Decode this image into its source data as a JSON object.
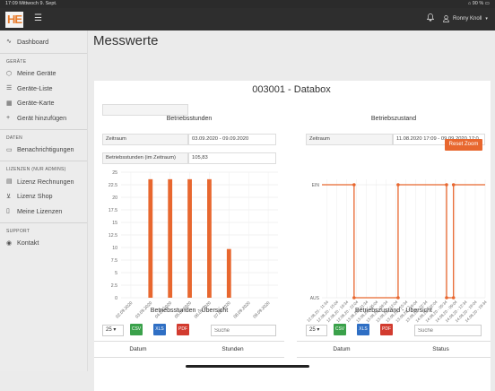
{
  "status_bar": {
    "time_date": "17:09  Mittwoch 9. Sept.",
    "battery": "90 %"
  },
  "app": {
    "logo_text": "HE",
    "user_name": "Ronny Knoll"
  },
  "sidebar": {
    "dashboard": "Dashboard",
    "sections": [
      {
        "title": "GERÄTE",
        "items": [
          {
            "label": "Meine Geräte",
            "icon": "cube-icon"
          },
          {
            "label": "Geräte-Liste",
            "icon": "list-icon"
          },
          {
            "label": "Geräte-Karte",
            "icon": "map-icon"
          },
          {
            "label": "Gerät hinzufügen",
            "icon": "plus-icon"
          }
        ]
      },
      {
        "title": "DATEN",
        "items": [
          {
            "label": "Benachrichtigungen",
            "icon": "chat-icon"
          }
        ]
      },
      {
        "title": "LIZENZEN (NUR ADMINS)",
        "items": [
          {
            "label": "Lizenz Rechnungen",
            "icon": "document-icon"
          },
          {
            "label": "Lizenz Shop",
            "icon": "cart-icon"
          },
          {
            "label": "Meine Lizenzen",
            "icon": "file-icon"
          }
        ]
      },
      {
        "title": "SUPPORT",
        "items": [
          {
            "label": "Kontakt",
            "icon": "eye-icon"
          }
        ]
      }
    ]
  },
  "page": {
    "title": "Messwerte",
    "device_title": "003001 - Databox"
  },
  "left_panel": {
    "title": "Betriebsstunden",
    "zeitraum_label": "Zeitraum",
    "zeitraum_value": "03.09.2020 - 09.09.2020",
    "hours_label": "Betriebsstunden (im Zeitraum)",
    "hours_value": "105,83",
    "table_title": "Betriebsstunden - Übersicht",
    "page_size": "25",
    "search_placeholder": "Suche",
    "col1": "Datum",
    "col2": "Stunden"
  },
  "right_panel": {
    "title": "Betriebszustand",
    "zeitraum_label": "Zeitraum",
    "zeitraum_value": "11.08.2020 17:09 - 09.09.2020 17:0",
    "reset_label": "Reset Zoom",
    "table_title": "Betriebszustand - Übersicht",
    "page_size": "25",
    "search_placeholder": "Suche",
    "col1": "Datum",
    "col2": "Status"
  },
  "export_buttons": [
    {
      "label": "CSV",
      "color": "#3aa14a"
    },
    {
      "label": "XLS",
      "color": "#2f6fc4"
    },
    {
      "label": "PDF",
      "color": "#d23b2f"
    }
  ],
  "chart_data": [
    {
      "type": "bar",
      "title": "Betriebsstunden",
      "categories": [
        "02.09.2020",
        "03.09.2020",
        "04.09.2020",
        "05.09.2020",
        "06.09.2020",
        "07.09.2020",
        "08.09.2020",
        "09.09.2020"
      ],
      "values": [
        0,
        23.6,
        23.6,
        23.6,
        23.6,
        9.7,
        0,
        0
      ],
      "ylim": [
        0,
        25
      ],
      "yticks": [
        "0",
        "2.5",
        "5",
        "7.5",
        "10",
        "12.5",
        "15",
        "17.5",
        "20",
        "22.5",
        "25"
      ],
      "color": "#e8672f"
    },
    {
      "type": "line",
      "title": "Betriebszustand",
      "step": true,
      "yticks": [
        "AUS",
        "EIN"
      ],
      "xticks": [
        "12.08.20 - 11:34",
        "12.08.20 - 15:04",
        "12.08.20 - 18:34",
        "12.08.20 - 22:04",
        "13.08.20 - 01:34",
        "13.08.20 - 05:04",
        "13.08.20 - 08:34",
        "13.08.20 - 12:04",
        "13.08.20 - 15:34",
        "13.08.20 - 19:04",
        "13.08.20 - 22:34",
        "14.08.20 - 02:04",
        "14.08.20 - 05:34",
        "14.08.20 - 09:04",
        "14.08.20 - 12:34",
        "14.08.20 - 16:04",
        "14.08.20 - 19:34"
      ],
      "x": [
        0,
        3.25,
        3.25,
        7.7,
        7.7,
        12.6,
        12.6,
        13.3,
        13.3,
        16.5
      ],
      "y": [
        1,
        1,
        0,
        0,
        1,
        1,
        0,
        0,
        1,
        1
      ],
      "markers": [
        [
          3.25,
          1
        ],
        [
          3.25,
          0
        ],
        [
          7.7,
          0
        ],
        [
          7.7,
          1
        ],
        [
          12.6,
          1
        ],
        [
          12.6,
          0
        ],
        [
          13.3,
          0
        ],
        [
          13.3,
          1
        ]
      ],
      "color": "#e8672f"
    }
  ]
}
